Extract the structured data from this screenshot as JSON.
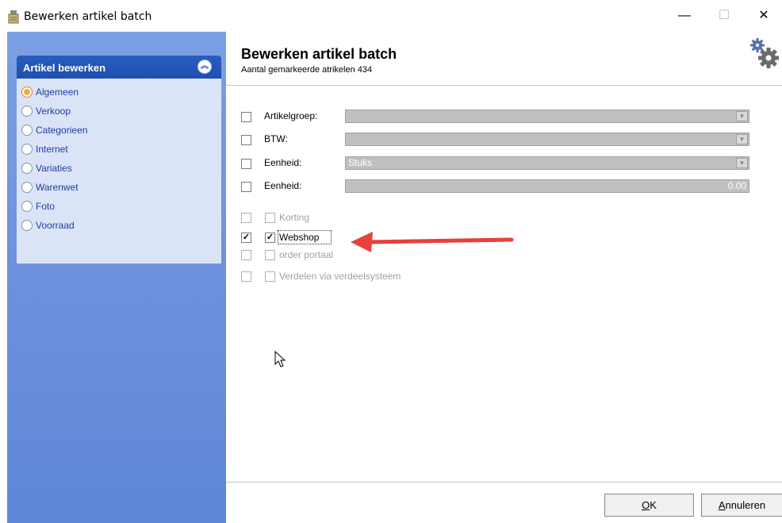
{
  "window": {
    "title": "Bewerken artikel batch",
    "minimize_glyph": "—",
    "maximize_glyph": "☐",
    "close_glyph": "✕"
  },
  "sidebar": {
    "panel_title": "Artikel bewerken",
    "collapse_glyph": "︽",
    "items": [
      {
        "label": "Algemeen",
        "selected": true
      },
      {
        "label": "Verkoop",
        "selected": false
      },
      {
        "label": "Categorieen",
        "selected": false
      },
      {
        "label": "Internet",
        "selected": false
      },
      {
        "label": "Variaties",
        "selected": false
      },
      {
        "label": "Warenwet",
        "selected": false
      },
      {
        "label": "Foto",
        "selected": false
      },
      {
        "label": "Voorraad",
        "selected": false
      }
    ]
  },
  "header": {
    "title": "Bewerken artikel batch",
    "subtitle": "Aantal gemarkeerde atrikelen 434",
    "icon": "gears-icon"
  },
  "form": {
    "fields": [
      {
        "label": "Artikelgroep:",
        "value": "",
        "checked": false
      },
      {
        "label": "BTW:",
        "value": "",
        "checked": false
      },
      {
        "label": "Eenheid:",
        "value": "Stuks",
        "checked": false
      },
      {
        "label": "Eenheid:",
        "value": "0.00",
        "checked": false
      }
    ],
    "options": [
      {
        "label": "Korting",
        "outer_checked": false,
        "inner_checked": false,
        "enabled": false
      },
      {
        "label": "Webshop",
        "outer_checked": true,
        "inner_checked": true,
        "enabled": true
      },
      {
        "label": "order portaal",
        "outer_checked": false,
        "inner_checked": false,
        "enabled": false
      },
      {
        "label": "Verdelen via verdeelsysteem",
        "outer_checked": false,
        "inner_checked": false,
        "enabled": false
      }
    ]
  },
  "footer": {
    "ok_label_u": "O",
    "ok_label_rest": "K",
    "cancel_label_u": "A",
    "cancel_label_rest": "nnuleren"
  },
  "colors": {
    "sidebar_bg": "#6b8edc",
    "panel_header": "#2a5bc0",
    "arrow": "#e8403a"
  }
}
